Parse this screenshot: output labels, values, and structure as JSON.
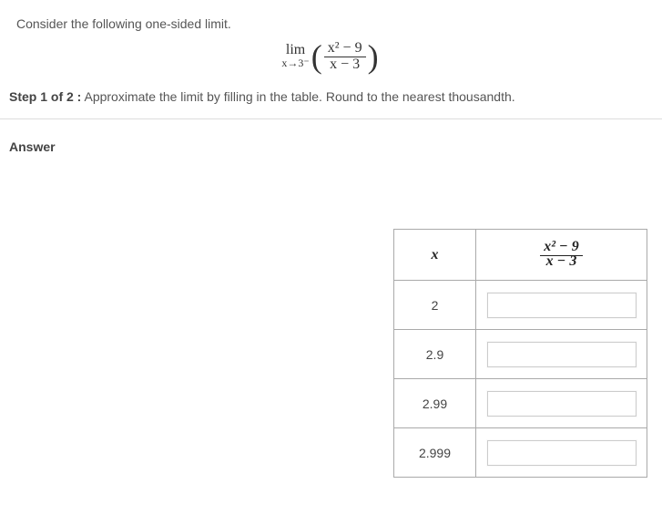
{
  "intro": "Consider the following one-sided limit.",
  "limit": {
    "lim_label": "lim",
    "approach": "x→3⁻",
    "frac_num": "x² − 9",
    "frac_den": "x − 3"
  },
  "step": {
    "label": "Step 1 of 2 :",
    "text": "  Approximate the limit by filling in the table. Round to the nearest thousandth."
  },
  "answer_label": "Answer",
  "table": {
    "hx": "x",
    "hy_num": "x² − 9",
    "hy_den": "x − 3",
    "rows": [
      {
        "x": "2",
        "y": ""
      },
      {
        "x": "2.9",
        "y": ""
      },
      {
        "x": "2.99",
        "y": ""
      },
      {
        "x": "2.999",
        "y": ""
      }
    ]
  }
}
